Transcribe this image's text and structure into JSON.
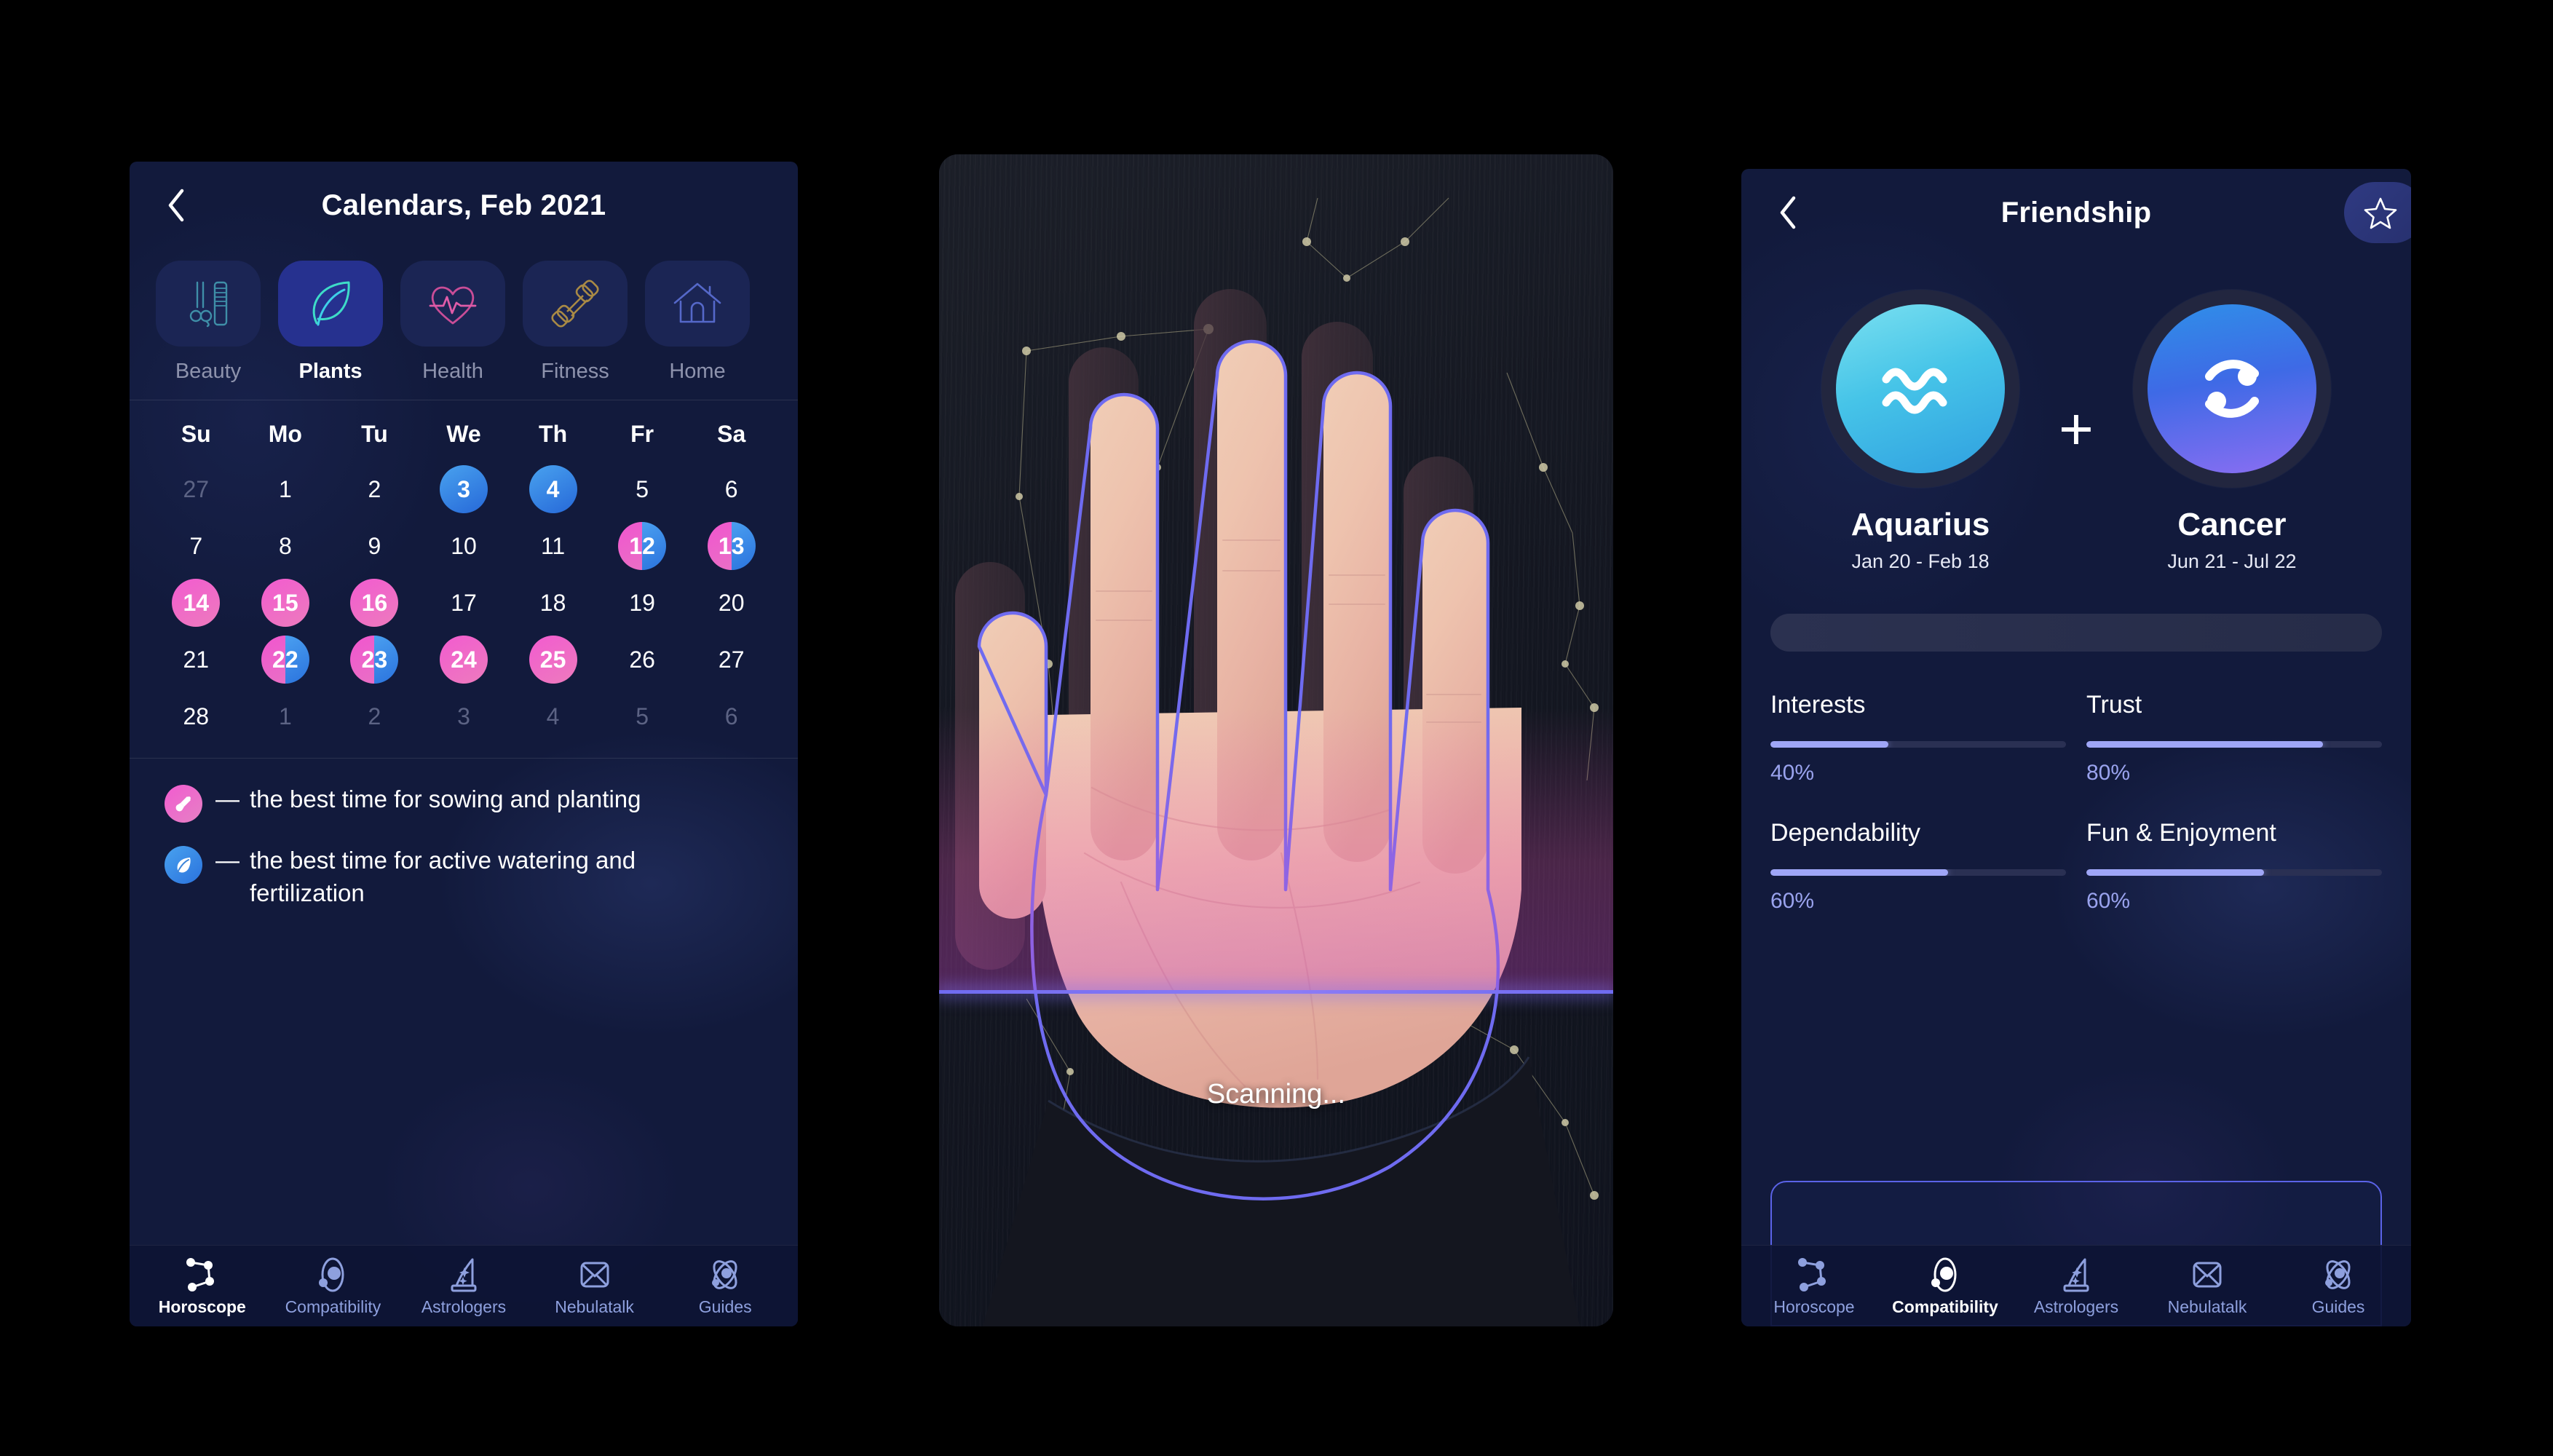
{
  "panel1": {
    "header": {
      "title": "Calendars, Feb 2021",
      "back_icon": "chevron-left-icon"
    },
    "categories": [
      {
        "label": "Beauty",
        "icon": "scissors-comb-icon",
        "active": false
      },
      {
        "label": "Plants",
        "icon": "leaf-icon",
        "active": true
      },
      {
        "label": "Health",
        "icon": "heart-pulse-icon",
        "active": false
      },
      {
        "label": "Fitness",
        "icon": "dumbbell-icon",
        "active": false
      },
      {
        "label": "Home",
        "icon": "house-icon",
        "active": false
      }
    ],
    "calendar": {
      "weekdays": [
        "Su",
        "Mo",
        "Tu",
        "We",
        "Th",
        "Fr",
        "Sa"
      ],
      "weeks": [
        [
          {
            "d": "27",
            "s": "muted"
          },
          {
            "d": "1",
            "s": ""
          },
          {
            "d": "2",
            "s": ""
          },
          {
            "d": "3",
            "s": "blue"
          },
          {
            "d": "4",
            "s": "blue"
          },
          {
            "d": "5",
            "s": ""
          },
          {
            "d": "6",
            "s": ""
          }
        ],
        [
          {
            "d": "7",
            "s": ""
          },
          {
            "d": "8",
            "s": ""
          },
          {
            "d": "9",
            "s": ""
          },
          {
            "d": "10",
            "s": ""
          },
          {
            "d": "11",
            "s": ""
          },
          {
            "d": "12",
            "s": "split"
          },
          {
            "d": "13",
            "s": "split"
          }
        ],
        [
          {
            "d": "14",
            "s": "pink"
          },
          {
            "d": "15",
            "s": "pink"
          },
          {
            "d": "16",
            "s": "pink"
          },
          {
            "d": "17",
            "s": ""
          },
          {
            "d": "18",
            "s": ""
          },
          {
            "d": "19",
            "s": ""
          },
          {
            "d": "20",
            "s": ""
          }
        ],
        [
          {
            "d": "21",
            "s": ""
          },
          {
            "d": "22",
            "s": "split"
          },
          {
            "d": "23",
            "s": "split"
          },
          {
            "d": "24",
            "s": "pink"
          },
          {
            "d": "25",
            "s": "pink"
          },
          {
            "d": "26",
            "s": ""
          },
          {
            "d": "27",
            "s": ""
          }
        ],
        [
          {
            "d": "28",
            "s": ""
          },
          {
            "d": "1",
            "s": "muted"
          },
          {
            "d": "2",
            "s": "muted"
          },
          {
            "d": "3",
            "s": "muted"
          },
          {
            "d": "4",
            "s": "muted"
          },
          {
            "d": "5",
            "s": "muted"
          },
          {
            "d": "6",
            "s": "muted"
          }
        ]
      ]
    },
    "legend": [
      {
        "icon": "shovel-icon",
        "color": "pink",
        "dash": "—",
        "text": "the best time for sowing and planting"
      },
      {
        "icon": "leaf-icon",
        "color": "blue",
        "dash": "—",
        "text": "the best time for active watering and fertilization"
      }
    ]
  },
  "panel2": {
    "status_text": "Scanning...",
    "overlay": {
      "outline_color": "#6f6bf0",
      "band_color": "#ec54be"
    }
  },
  "panel3": {
    "header": {
      "title": "Friendship",
      "back_icon": "chevron-left-icon",
      "favorite_icon": "star-icon"
    },
    "signs": [
      {
        "name": "Aquarius",
        "dates": "Jan 20 - Feb 18",
        "icon": "aquarius-icon"
      },
      {
        "name": "Cancer",
        "dates": "Jun 21 - Jul 22",
        "icon": "cancer-icon"
      }
    ],
    "plus": "+",
    "stats": [
      {
        "label": "Interests",
        "value": "40%",
        "pct": 40
      },
      {
        "label": "Trust",
        "value": "80%",
        "pct": 80
      },
      {
        "label": "Dependability",
        "value": "60%",
        "pct": 60
      },
      {
        "label": "Fun & Enjoyment",
        "value": "60%",
        "pct": 60
      }
    ]
  },
  "tabbar": {
    "items": [
      {
        "label": "Horoscope",
        "icon": "constellation-icon"
      },
      {
        "label": "Compatibility",
        "icon": "planet-orbit-icon"
      },
      {
        "label": "Astrologers",
        "icon": "wizard-hat-icon"
      },
      {
        "label": "Nebulatalk",
        "icon": "envelope-icon"
      },
      {
        "label": "Guides",
        "icon": "atom-icon"
      }
    ],
    "active_panel1": "Horoscope",
    "active_panel3": "Compatibility"
  },
  "colors": {
    "panel_bg": "#121a3c",
    "pink": "#f155cf",
    "blue": "#2e86e8",
    "accent": "#9fa6f7",
    "tab_inactive": "#8ea0de"
  }
}
